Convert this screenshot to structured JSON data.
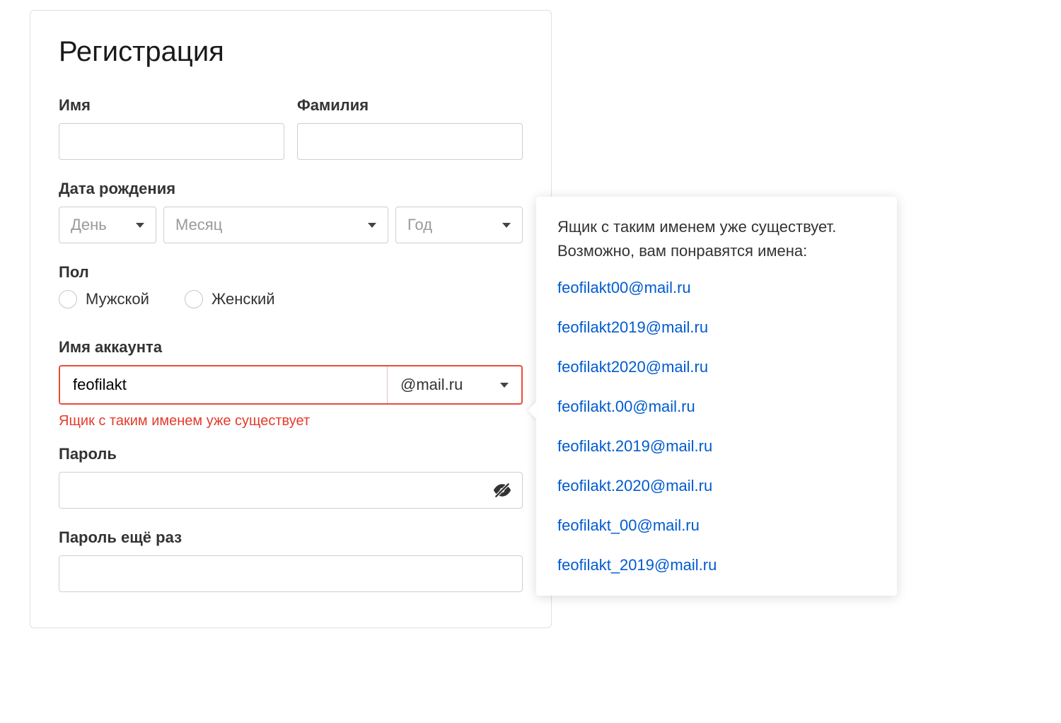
{
  "title": "Регистрация",
  "labels": {
    "firstName": "Имя",
    "lastName": "Фамилия",
    "dob": "Дата рождения",
    "gender": "Пол",
    "account": "Имя аккаунта",
    "password": "Пароль",
    "passwordConfirm": "Пароль ещё раз"
  },
  "dob": {
    "day": "День",
    "month": "Месяц",
    "year": "Год"
  },
  "gender": {
    "male": "Мужской",
    "female": "Женский"
  },
  "account": {
    "value": "feofilakt",
    "domain": "@mail.ru",
    "error": "Ящик с таким именем уже существует"
  },
  "popup": {
    "line1": "Ящик с таким именем уже существует.",
    "line2": "Возможно, вам понравятся имена:",
    "suggestions": [
      "feofilakt00@mail.ru",
      "feofilakt2019@mail.ru",
      "feofilakt2020@mail.ru",
      "feofilakt.00@mail.ru",
      "feofilakt.2019@mail.ru",
      "feofilakt.2020@mail.ru",
      "feofilakt_00@mail.ru",
      "feofilakt_2019@mail.ru"
    ]
  },
  "colors": {
    "error": "#e53b2c",
    "link": "#005bd1",
    "border": "#cfcfcf"
  }
}
